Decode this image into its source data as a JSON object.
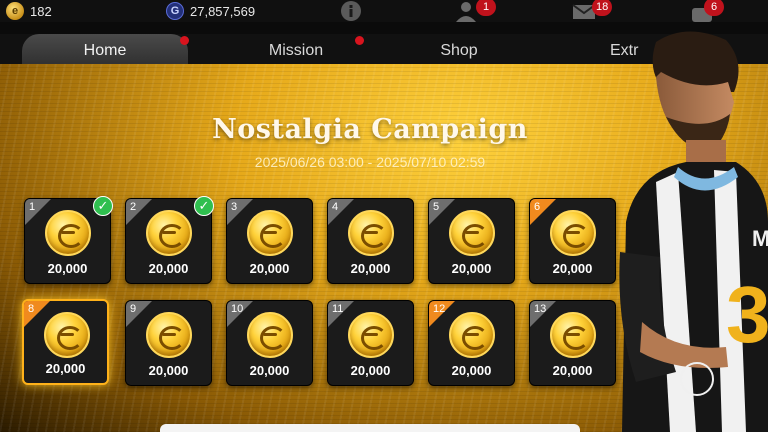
{
  "status": {
    "coins": "182",
    "gp": "27,857,569",
    "friends_badge": "1",
    "mail_badge": "18",
    "notif_badge": "6"
  },
  "tabs": [
    {
      "label": "Home"
    },
    {
      "label": "Mission"
    },
    {
      "label": "Shop"
    },
    {
      "label": "Extr"
    }
  ],
  "campaign": {
    "title": "Nostalgia Campaign",
    "period": "2025/06/26 03:00 - 2025/07/10 02:59"
  },
  "rewards": [
    {
      "day": "1",
      "amount": "20,000"
    },
    {
      "day": "2",
      "amount": "20,000"
    },
    {
      "day": "3",
      "amount": "20,000"
    },
    {
      "day": "4",
      "amount": "20,000"
    },
    {
      "day": "5",
      "amount": "20,000"
    },
    {
      "day": "6",
      "amount": "20,000"
    },
    {
      "day": "8",
      "amount": "20,000"
    },
    {
      "day": "9",
      "amount": "20,000"
    },
    {
      "day": "10",
      "amount": "20,000"
    },
    {
      "day": "11",
      "amount": "20,000"
    },
    {
      "day": "12",
      "amount": "20,000"
    },
    {
      "day": "13",
      "amount": "20,000"
    }
  ],
  "player": {
    "shirt_number": "3"
  },
  "colors": {
    "accent": "#f08a1e",
    "claimed": "#2fbf4f",
    "badge": "#c0121c"
  }
}
